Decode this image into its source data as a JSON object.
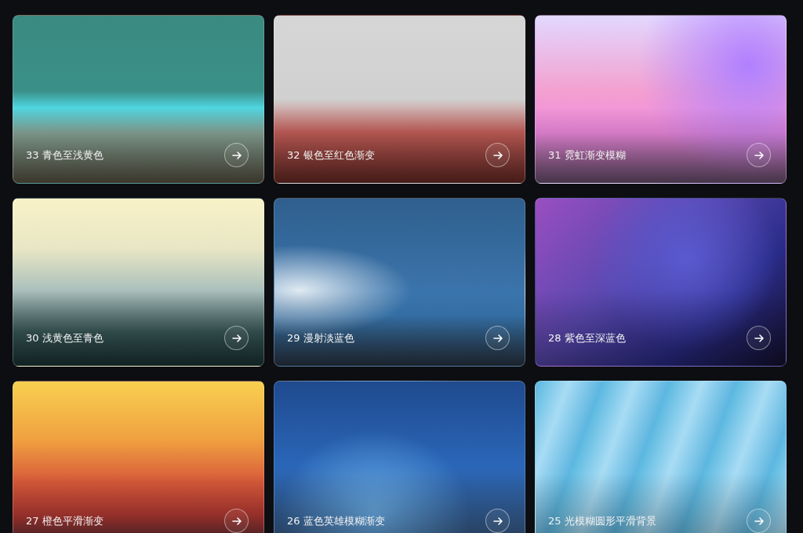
{
  "cards": [
    {
      "title": "33 青色至浅黄色"
    },
    {
      "title": "32 银色至红色渐变"
    },
    {
      "title": "31 霓虹渐变模糊"
    },
    {
      "title": "30 浅黄色至青色"
    },
    {
      "title": "29 漫射淡蓝色"
    },
    {
      "title": "28 紫色至深蓝色"
    },
    {
      "title": "27 橙色平滑渐变"
    },
    {
      "title": "26 蓝色英雄模糊渐变"
    },
    {
      "title": "25 光模糊圆形平滑背景"
    }
  ]
}
